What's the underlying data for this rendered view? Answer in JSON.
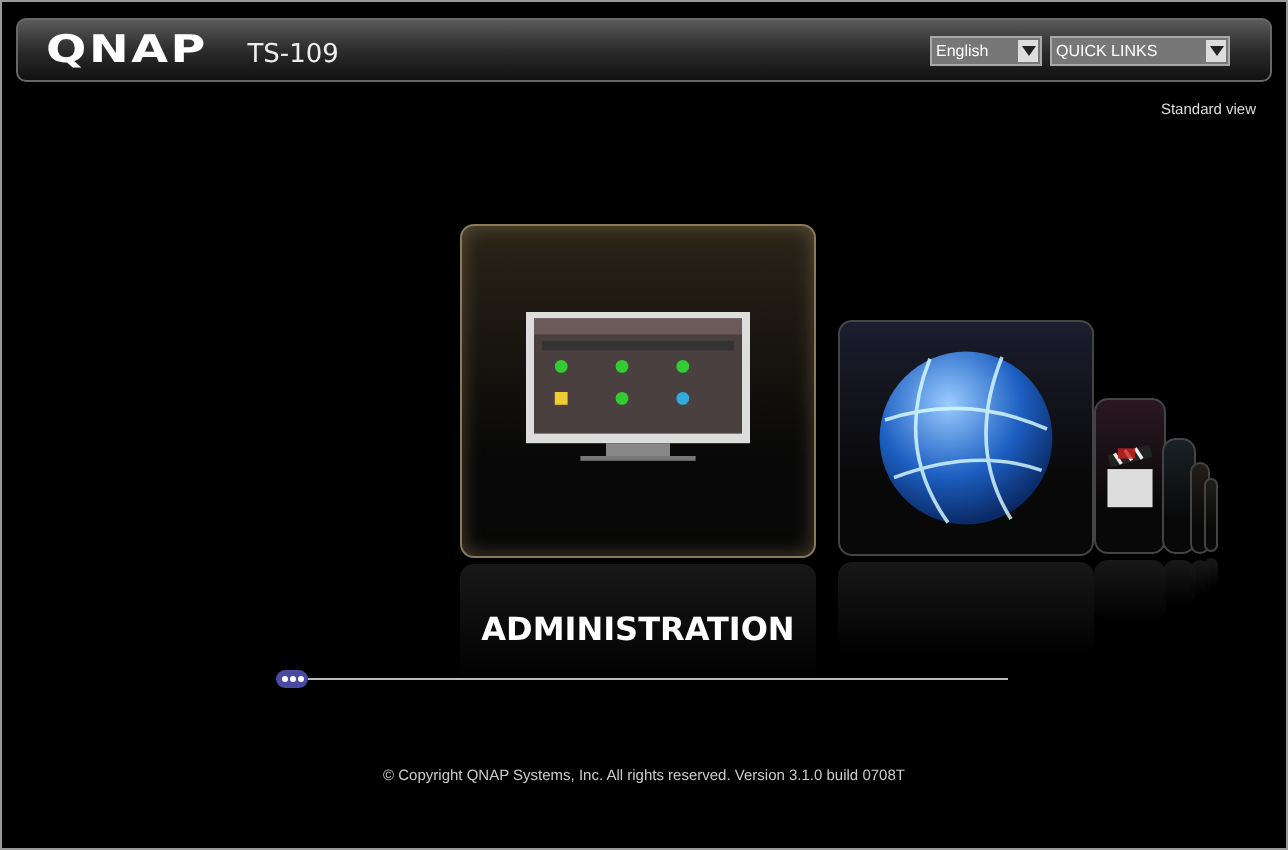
{
  "header": {
    "logo": "QNAP",
    "model": "TS-109",
    "language_select": {
      "value": "English"
    },
    "quick_links_select": {
      "value": "QUICK LINKS"
    }
  },
  "view_link": "Standard view",
  "carousel": {
    "items": [
      {
        "kind": "monitor",
        "selected": true
      },
      {
        "kind": "globe",
        "selected": false
      },
      {
        "kind": "film",
        "selected": false
      },
      {
        "kind": "plain",
        "selected": false
      },
      {
        "kind": "plain",
        "selected": false
      },
      {
        "kind": "plain",
        "selected": false
      }
    ],
    "caption": "ADMINISTRATION"
  },
  "footer": "© Copyright QNAP Systems, Inc. All rights reserved. Version 3.1.0 build 0708T"
}
